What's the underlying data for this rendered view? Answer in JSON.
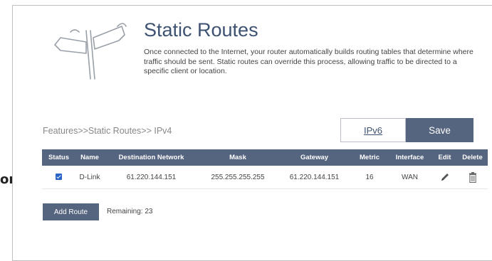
{
  "outside_label": "ora",
  "header": {
    "title": "Static Routes",
    "description": "Once connected to the Internet, your router automatically builds routing tables that determine where traffic should be sent. Static routes can override this process, allowing traffic to be directed to a specific client or location.",
    "icon": "signpost-icon"
  },
  "breadcrumb": "Features>>Static Routes>> IPv4",
  "buttons": {
    "ipv6": "IPv6",
    "save": "Save",
    "add_route": "Add Route"
  },
  "table": {
    "headers": [
      "Status",
      "Name",
      "Destination Network",
      "Mask",
      "Gateway",
      "Metric",
      "Interface",
      "Edit",
      "Delete"
    ],
    "rows": [
      {
        "status_checked": true,
        "name": "D-Link",
        "destination": "61.220.144.151",
        "mask": "255.255.255.255",
        "gateway": "61.220.144.151",
        "metric": "16",
        "interface": "WAN",
        "edit_icon": "pencil-icon",
        "delete_icon": "trash-icon"
      }
    ]
  },
  "remaining": {
    "label": "Remaining:",
    "value": "23"
  },
  "colors": {
    "accent": "#55647f",
    "title": "#3e5271",
    "checkbox": "#2a63c8"
  }
}
